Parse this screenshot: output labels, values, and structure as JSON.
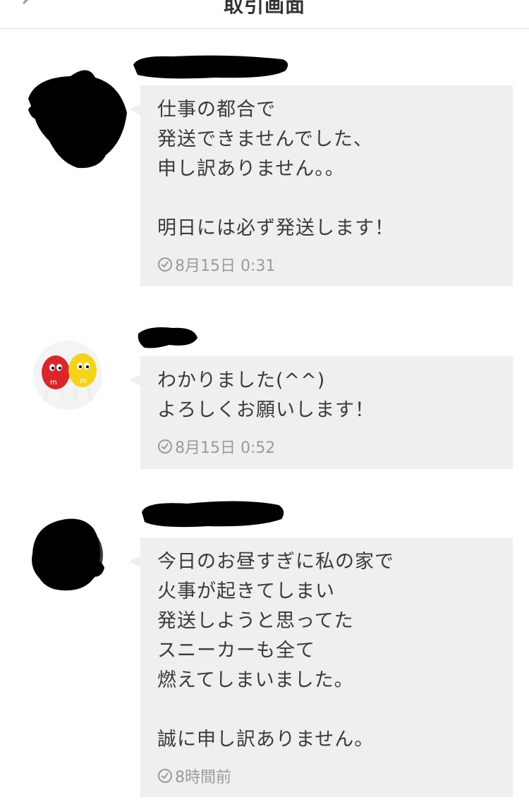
{
  "header": {
    "title": "取引画面",
    "back_icon": "chevron-left-icon"
  },
  "messages": [
    {
      "text": "仕事の都合で\n発送できませんでした、\n申し訳ありません。。\n\n明日には必ず発送します！",
      "timestamp": "8月15日 0:31",
      "name_redacted": true,
      "avatar_redacted": true
    },
    {
      "text": "わかりました(^^)\nよろしくお願いします！",
      "timestamp": "8月15日 0:52",
      "name_redacted": true,
      "avatar_redacted": false
    },
    {
      "text": "今日のお昼すぎに私の家で\n火事が起きてしまい\n発送しようと思ってた\nスニーカーも全て\n燃えてしまいました。\n\n誠に申し訳ありません。",
      "timestamp": "8時間前",
      "name_redacted": true,
      "avatar_redacted": true
    }
  ],
  "colors": {
    "bubble_bg": "#efefef",
    "text": "#3a3a3a",
    "timestamp": "#9a9a9a",
    "redaction": "#000000"
  }
}
